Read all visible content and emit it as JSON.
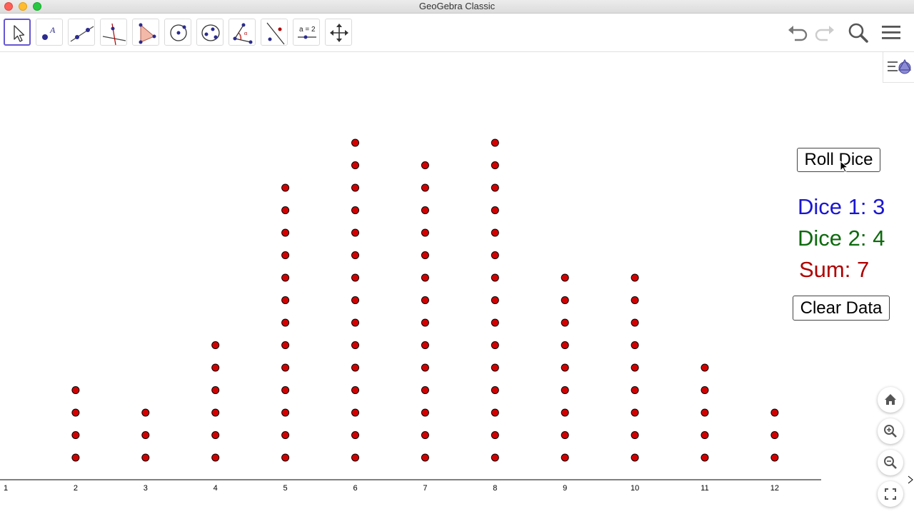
{
  "window": {
    "title": "GeoGebra Classic"
  },
  "toolbar": {
    "tools": [
      {
        "name": "move-tool",
        "icon": "pointer-arrow-icon"
      },
      {
        "name": "point-tool",
        "icon": "point-icon"
      },
      {
        "name": "line-tool",
        "icon": "line-icon"
      },
      {
        "name": "perpendicular-line-tool",
        "icon": "perpendicular-icon"
      },
      {
        "name": "polygon-tool",
        "icon": "polygon-icon"
      },
      {
        "name": "circle-tool",
        "icon": "circle-icon"
      },
      {
        "name": "ellipse-tool",
        "icon": "ellipse-icon"
      },
      {
        "name": "angle-tool",
        "icon": "angle-icon"
      },
      {
        "name": "reflect-tool",
        "icon": "reflect-icon"
      },
      {
        "name": "slider-tool",
        "icon": "slider-icon",
        "label": "a = 2"
      },
      {
        "name": "move-graphics-tool",
        "icon": "move-arrows-icon"
      }
    ],
    "active_tool": "move-tool",
    "right": [
      "undo-icon",
      "redo-icon",
      "search-icon",
      "menu-icon"
    ]
  },
  "buttons": {
    "roll": "Roll Dice",
    "clear": "Clear Data"
  },
  "results": {
    "dice1": "Dice 1: 3",
    "dice2": "Dice 2: 4",
    "sum": "Sum: 7",
    "colors": {
      "dice1": "#1a16d2",
      "dice2": "#0c6a0c",
      "sum": "#b00000"
    }
  },
  "axis": {
    "tick_labels": [
      "1",
      "2",
      "3",
      "4",
      "5",
      "6",
      "7",
      "8",
      "9",
      "10",
      "11",
      "12"
    ]
  },
  "chart_data": {
    "type": "scatter",
    "title": "",
    "xlabel": "",
    "ylabel": "",
    "x": [
      1,
      2,
      3,
      4,
      5,
      6,
      7,
      8,
      9,
      10,
      11,
      12
    ],
    "counts": [
      0,
      4,
      3,
      6,
      13,
      15,
      14,
      15,
      9,
      9,
      5,
      3
    ],
    "point_color": "#d40000",
    "grid": false
  },
  "nav": [
    "home-icon",
    "zoom-in-icon",
    "zoom-out-icon",
    "fullscreen-icon"
  ]
}
